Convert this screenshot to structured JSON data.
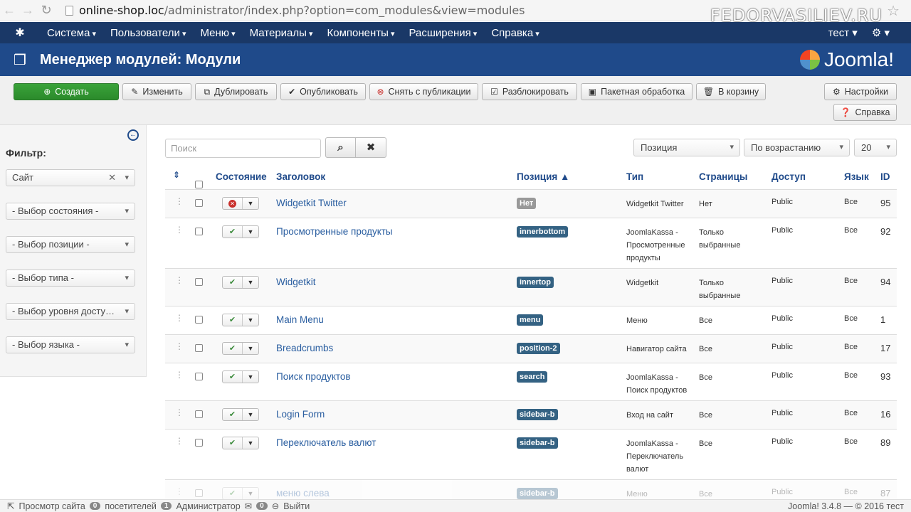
{
  "browser": {
    "url_host": "online-shop.loc",
    "url_path": "/administrator/index.php?option=com_modules&view=modules",
    "watermark": "FEDORVASILIEV.RU"
  },
  "topnav": {
    "items": [
      "Система",
      "Пользователи",
      "Меню",
      "Материалы",
      "Компоненты",
      "Расширения",
      "Справка"
    ],
    "user": "тест ▾"
  },
  "header": {
    "title": "Менеджер модулей: Модули",
    "brand": "Joomla!"
  },
  "toolbar": {
    "create": "Создать",
    "edit": "Изменить",
    "duplicate": "Дублировать",
    "publish": "Опубликовать",
    "unpublish": "Снять с публикации",
    "unlock": "Разблокировать",
    "batch": "Пакетная обработка",
    "trash": "В корзину",
    "options": "Настройки",
    "help": "Справка"
  },
  "sidebar": {
    "filter_title": "Фильтр:",
    "site": "Сайт",
    "state": "- Выбор состояния -",
    "position": "- Выбор позиции -",
    "type": "- Выбор типа -",
    "access": "- Выбор уровня досту…",
    "language": "- Выбор языка -"
  },
  "search": {
    "placeholder": "Поиск",
    "sort_field": "Позиция",
    "sort_dir": "По возрастанию",
    "limit": "20"
  },
  "table": {
    "headers": {
      "status": "Состояние",
      "title": "Заголовок",
      "position": "Позиция ▲",
      "type": "Тип",
      "pages": "Страницы",
      "access": "Доступ",
      "language": "Язык",
      "id": "ID"
    },
    "rows": [
      {
        "title": "Widgetkit Twitter",
        "position": "Нет",
        "type": "Widgetkit Twitter",
        "pages": "Нет",
        "access": "Public",
        "language": "Все",
        "id": "95"
      },
      {
        "title": "Просмотренные продукты",
        "position": "innerbottom",
        "type": "JoomlaKassa - Просмотренные продукты",
        "pages": "Только выбранные",
        "access": "Public",
        "language": "Все",
        "id": "92"
      },
      {
        "title": "Widgetkit",
        "position": "innertop",
        "type": "Widgetkit",
        "pages": "Только выбранные",
        "access": "Public",
        "language": "Все",
        "id": "94"
      },
      {
        "title": "Main Menu",
        "position": "menu",
        "type": "Меню",
        "pages": "Все",
        "access": "Public",
        "language": "Все",
        "id": "1"
      },
      {
        "title": "Breadcrumbs",
        "position": "position-2",
        "type": "Навигатор сайта",
        "pages": "Все",
        "access": "Public",
        "language": "Все",
        "id": "17"
      },
      {
        "title": "Поиск продуктов",
        "position": "search",
        "type": "JoomlaKassa - Поиск продуктов",
        "pages": "Все",
        "access": "Public",
        "language": "Все",
        "id": "93"
      },
      {
        "title": "Login Form",
        "position": "sidebar-b",
        "type": "Вход на сайт",
        "pages": "Все",
        "access": "Public",
        "language": "Все",
        "id": "16"
      },
      {
        "title": "Переключатель валют",
        "position": "sidebar-b",
        "type": "JoomlaKassa - Переключатель валют",
        "pages": "Все",
        "access": "Public",
        "language": "Все",
        "id": "89"
      },
      {
        "title": "меню слева",
        "position": "sidebar-b",
        "type": "Меню",
        "pages": "Все",
        "access": "Public",
        "language": "Все",
        "id": "87"
      }
    ]
  },
  "statusbar": {
    "view_site": "Просмотр сайта",
    "visitors_count": "0",
    "visitors": "посетителей",
    "admins_count": "1",
    "admins": "Администратор",
    "messages_count": "0",
    "logout": "Выйти",
    "version": "Joomla! 3.4.8 — © 2016 тест"
  }
}
